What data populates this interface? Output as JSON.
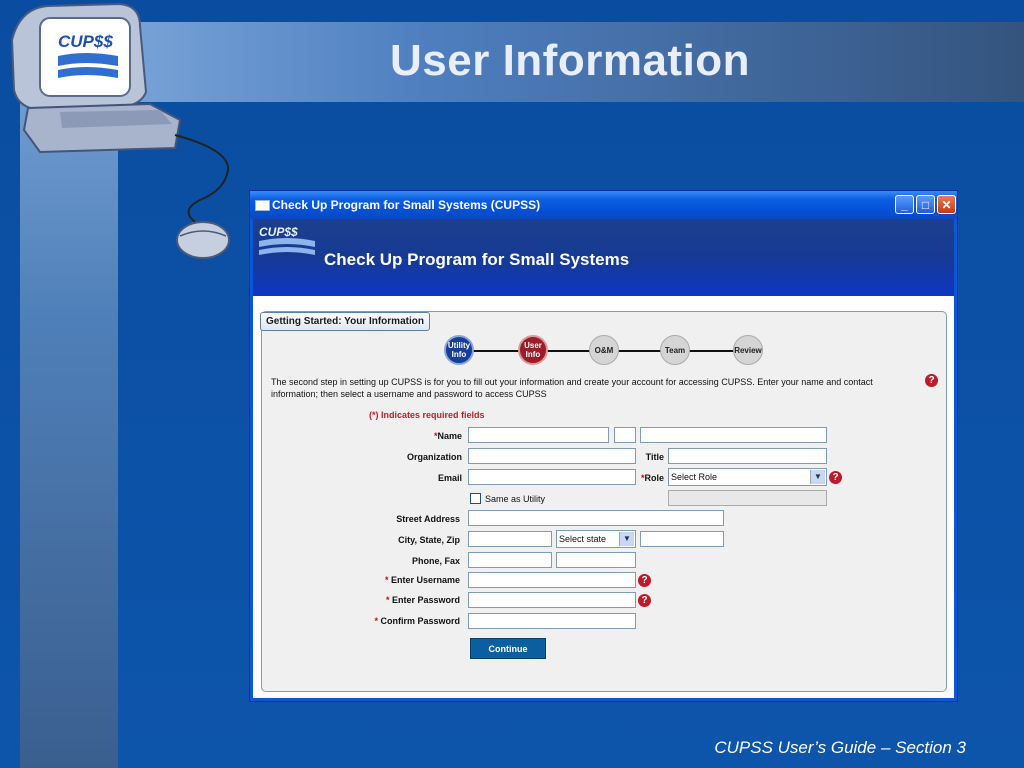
{
  "slide": {
    "title": "User Information",
    "footer": "CUPSS User’s Guide – Section 3",
    "logo_text": "CUP$$"
  },
  "window": {
    "title": "Check Up Program for Small Systems (CUPSS)",
    "banner_title": "Check Up Program for Small Systems",
    "banner_logo": "CUP$$",
    "buttons": {
      "minimize": "_",
      "maximize": "□",
      "close": "✕"
    }
  },
  "panel": {
    "tab_label": "Getting Started: Your Information",
    "steps": [
      {
        "label": "Utility\nInfo",
        "state": "done"
      },
      {
        "label": "User\nInfo",
        "state": "current"
      },
      {
        "label": "O&M",
        "state": "todo"
      },
      {
        "label": "Team",
        "state": "todo"
      },
      {
        "label": "Review",
        "state": "todo"
      }
    ],
    "intro": "The second step in setting up CUPSS is for you to fill out your information and create your account for accessing CUPSS. Enter your name and contact information; then select a username and password to access CUPSS",
    "required_note": "(*) Indicates required fields",
    "labels": {
      "name": "Name",
      "organization": "Organization",
      "title": "Title",
      "email": "Email",
      "role": "Role",
      "street": "Street Address",
      "city_state_zip": "City, State, Zip",
      "phone_fax": "Phone, Fax",
      "username": "Enter Username",
      "password": "Enter Password",
      "confirm": "Confirm Password"
    },
    "required_mark": "*",
    "role_select": "Select Role",
    "state_select": "Select state",
    "same_as_utility": "Same as Utility",
    "continue_button": "Continue"
  },
  "colors": {
    "slide_bg": "#0b4f9e",
    "title_bar": "#0550d6",
    "step_done": "#163d9a",
    "step_current": "#9c1c2a",
    "required_red": "#c0202a",
    "continue_button": "#0c5ea0"
  }
}
